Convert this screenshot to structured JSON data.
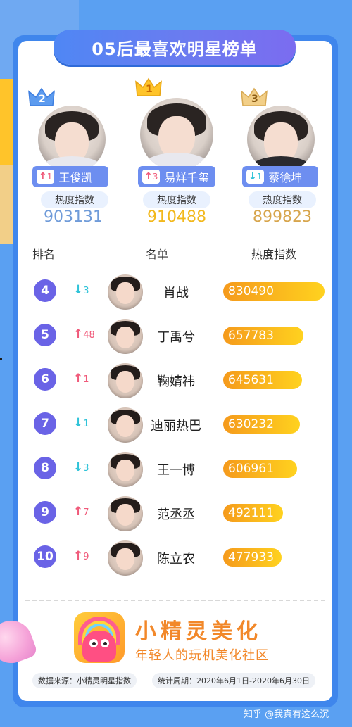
{
  "title": "05后最喜欢明星榜单",
  "podium_heat_label": "热度指数",
  "podium": [
    {
      "rank": "2",
      "name": "王俊凯",
      "trend_arrow": "↑",
      "trend_value": "1",
      "trend": "up",
      "heat": "903131",
      "ring_color": "#6fa9f2",
      "value_color": "#6f9bd9"
    },
    {
      "rank": "1",
      "name": "易烊千玺",
      "trend_arrow": "↑",
      "trend_value": "3",
      "trend": "up",
      "heat": "910488",
      "ring_color": "#ffc42a",
      "value_color": "#f2b81c"
    },
    {
      "rank": "3",
      "name": "蔡徐坤",
      "trend_arrow": "↓",
      "trend_value": "1",
      "trend": "down",
      "heat": "899823",
      "ring_color": "#f2cf88",
      "value_color": "#d7a54c"
    }
  ],
  "table_headers": {
    "rank": "排名",
    "name": "名单",
    "heat": "热度指数"
  },
  "rows": [
    {
      "rank": "4",
      "trend_arrow": "↓",
      "trend_value": "3",
      "trend": "down",
      "name": "肖战",
      "heat": "830490",
      "heat_value": 830490
    },
    {
      "rank": "5",
      "trend_arrow": "↑",
      "trend_value": "48",
      "trend": "up",
      "name": "丁禹兮",
      "heat": "657783",
      "heat_value": 657783
    },
    {
      "rank": "6",
      "trend_arrow": "↑",
      "trend_value": "1",
      "trend": "up",
      "name": "鞠婧祎",
      "heat": "645631",
      "heat_value": 645631
    },
    {
      "rank": "7",
      "trend_arrow": "↓",
      "trend_value": "1",
      "trend": "down",
      "name": "迪丽热巴",
      "heat": "630232",
      "heat_value": 630232
    },
    {
      "rank": "8",
      "trend_arrow": "↓",
      "trend_value": "3",
      "trend": "down",
      "name": "王一博",
      "heat": "606961",
      "heat_value": 606961
    },
    {
      "rank": "9",
      "trend_arrow": "↑",
      "trend_value": "7",
      "trend": "up",
      "name": "范丞丞",
      "heat": "492111",
      "heat_value": 492111
    },
    {
      "rank": "10",
      "trend_arrow": "↑",
      "trend_value": "9",
      "trend": "up",
      "name": "陈立农",
      "heat": "477933",
      "heat_value": 477933
    }
  ],
  "brand": {
    "name": "小精灵美化",
    "slogan": "年轻人的玩机美化社区"
  },
  "footer": {
    "source": "数据来源：小精灵明星指数",
    "period": "统计周期：2020年6月1日-2020年6月30日"
  },
  "watermark": "知乎 @我真有这么沉",
  "colors": {
    "rank_badge": "#6a63e6",
    "up": "#f05a7a",
    "down": "#2fc3d8",
    "bar_start": "#f59a1c",
    "bar_end": "#ffd21f",
    "background": "#5aa0f2"
  }
}
